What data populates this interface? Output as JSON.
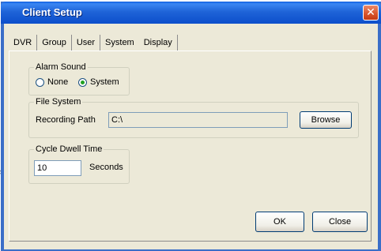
{
  "window": {
    "title": "Client Setup",
    "close_glyph": "✕"
  },
  "tabs": [
    {
      "label": "DVR"
    },
    {
      "label": "Group"
    },
    {
      "label": "User"
    },
    {
      "label": "System"
    },
    {
      "label": "Display"
    }
  ],
  "alarm_sound": {
    "legend": "Alarm Sound",
    "options": [
      "None",
      "System"
    ],
    "selected": "System"
  },
  "file_system": {
    "legend": "File System",
    "recording_path_label": "Recording Path",
    "recording_path_value": "C:\\",
    "browse_label": "Browse"
  },
  "cycle_dwell": {
    "legend": "Cycle Dwell Time",
    "value": "10",
    "unit": "Seconds"
  },
  "footer": {
    "ok_label": "OK",
    "close_label": "Close"
  },
  "side_glyph": "s",
  "colors": {
    "titlebar": "#0c4ecb",
    "dialog_bg": "#ece9d8",
    "radio_dot": "#21a121"
  }
}
